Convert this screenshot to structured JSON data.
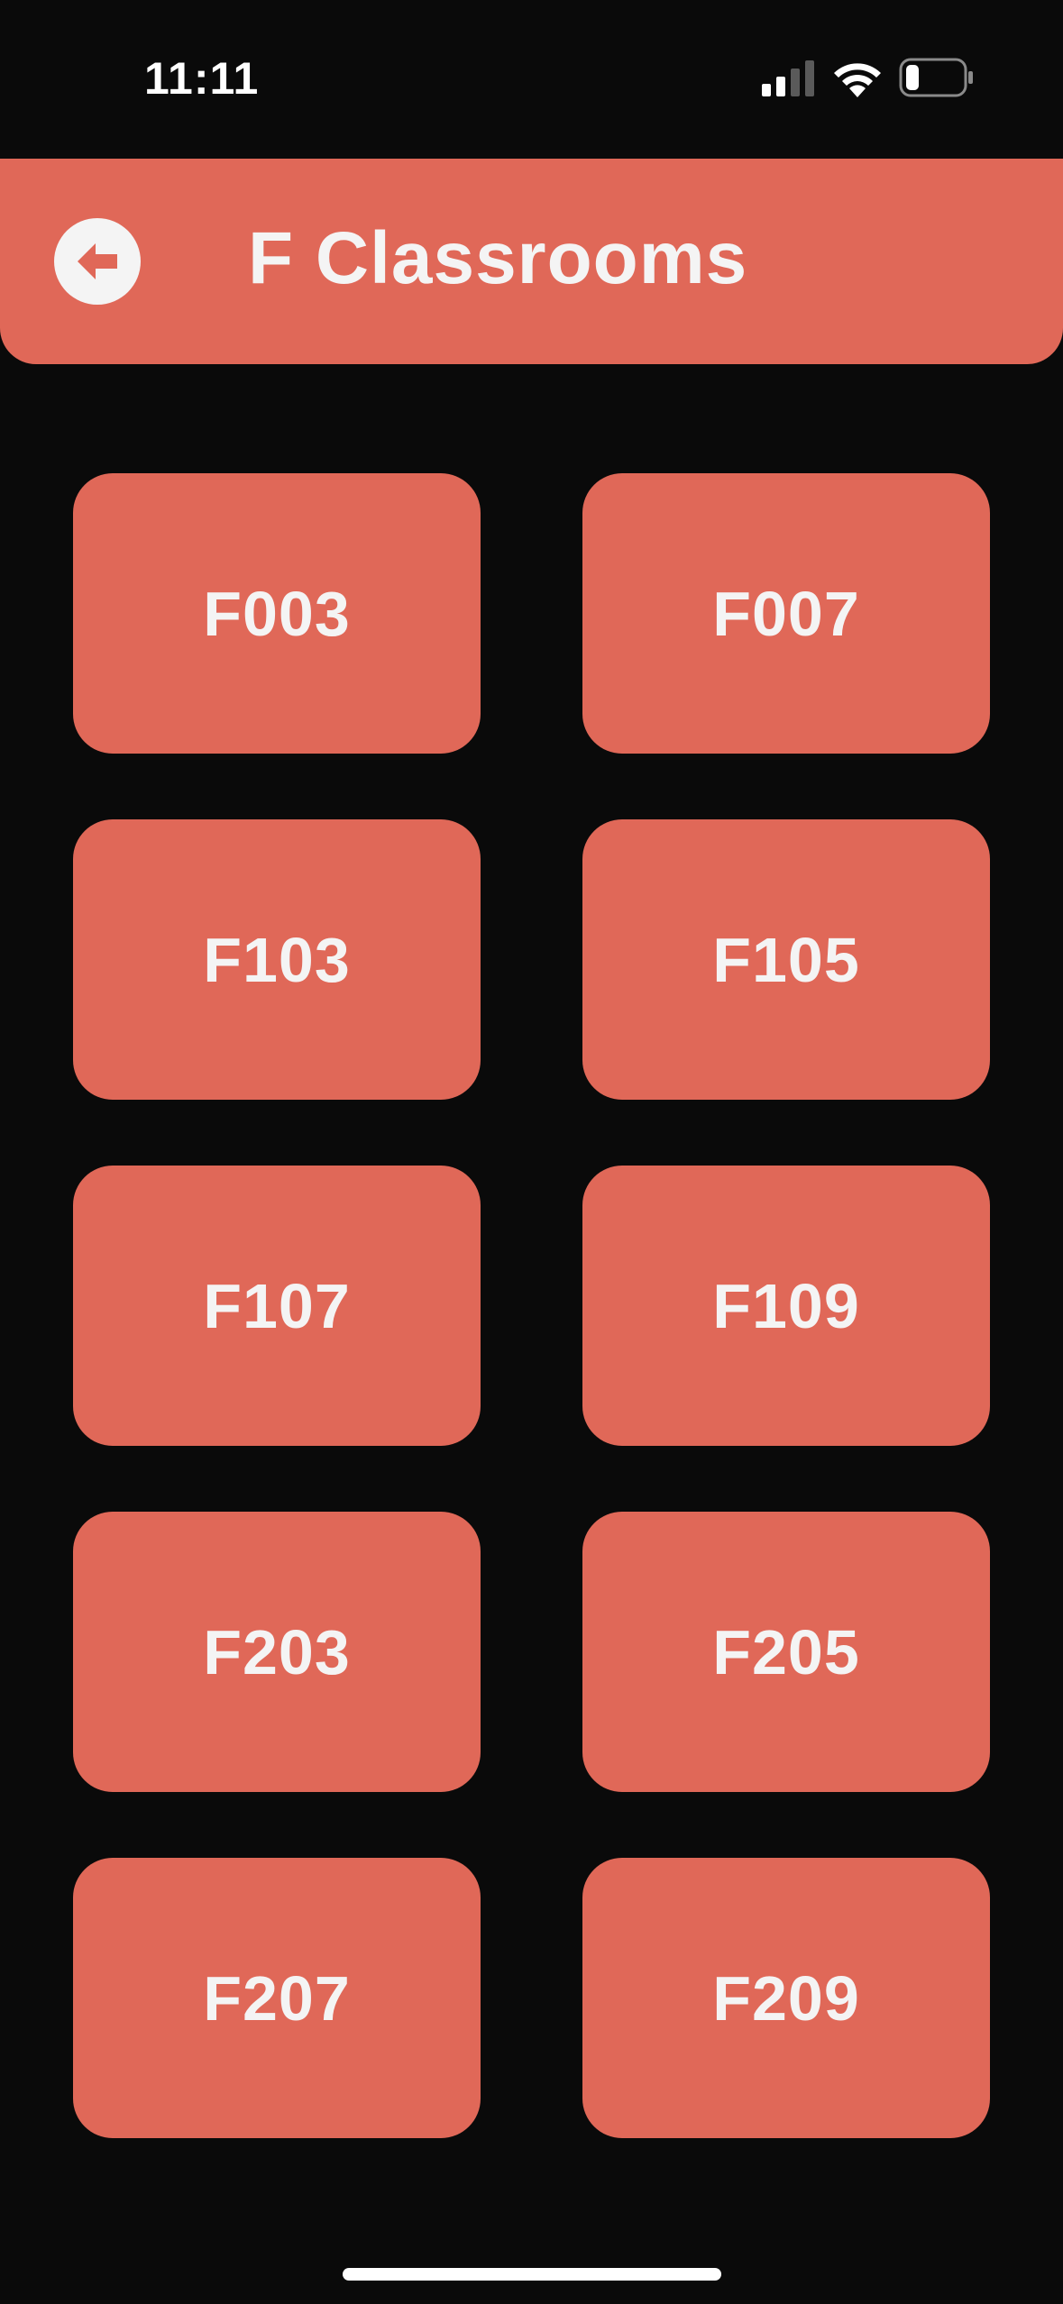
{
  "status_bar": {
    "time": "11:11",
    "icons": [
      "signal-icon",
      "wifi-icon",
      "battery-icon"
    ]
  },
  "header": {
    "title": "F Classrooms",
    "back_icon": "arrow-left-circle-icon"
  },
  "rooms": [
    "F003",
    "F007",
    "F103",
    "F105",
    "F107",
    "F109",
    "F203",
    "F205",
    "F207",
    "F209"
  ],
  "colors": {
    "accent": "#e06858",
    "background": "#0a0a0a",
    "text": "#f4f4f4"
  }
}
